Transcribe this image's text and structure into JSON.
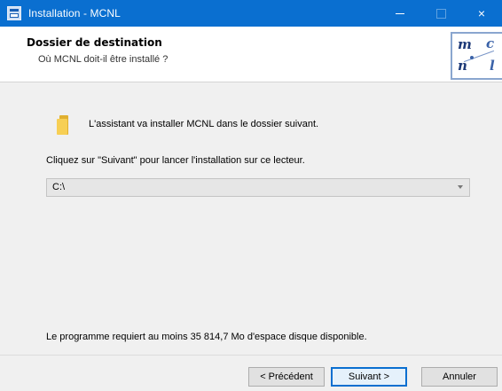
{
  "window": {
    "title": "Installation - MCNL",
    "controls": {
      "minimize_icon": "minimize-icon",
      "maximize_icon": "maximize-icon",
      "close_label": "×"
    }
  },
  "header": {
    "title": "Dossier de destination",
    "subtitle": "Où MCNL doit-il être installé ?",
    "logo": {
      "row1": [
        "m",
        "c"
      ],
      "row2": [
        "n",
        "l"
      ]
    }
  },
  "body": {
    "intro": "L'assistant va installer MCNL dans le dossier suivant.",
    "instruction": "Cliquez sur \"Suivant\" pour lancer l'installation sur ce lecteur.",
    "path": {
      "value": "C:\\",
      "icon": "chevron-down-icon"
    },
    "space_required": "Le programme requiert au moins 35 814,7 Mo d'espace disque disponible."
  },
  "buttons": {
    "back": "< Précédent",
    "next": "Suivant >",
    "cancel": "Annuler"
  },
  "colors": {
    "titlebar": "#0a6fd0",
    "header_bg": "#ffffff",
    "window_bg": "#f0f0f0",
    "default_button_border": "#0a6fd0",
    "folder": "#f7cf54"
  }
}
